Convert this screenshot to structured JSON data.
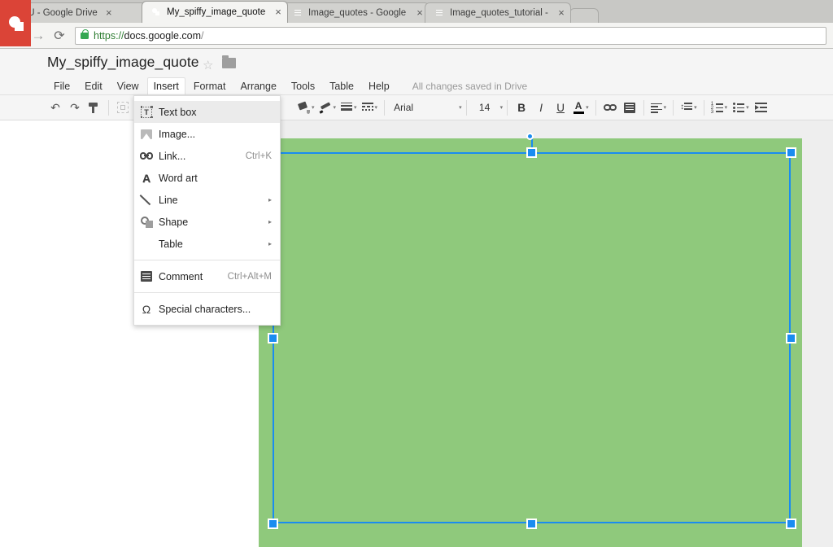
{
  "browser": {
    "tabs": [
      {
        "label": "IU - Google Drive",
        "favicon": "google-drive-icon",
        "active": false,
        "close": "×"
      },
      {
        "label": "My_spiffy_image_quote -",
        "favicon": "google-slides-icon",
        "active": true,
        "close": "×"
      },
      {
        "label": "Image_quotes - Google D",
        "favicon": "google-docs-icon",
        "active": false,
        "close": "×"
      },
      {
        "label": "Image_quotes_tutorial - G",
        "favicon": "google-docs-icon",
        "active": false,
        "close": "×"
      }
    ],
    "nav": {
      "back": "←",
      "forward": "→",
      "reload": "⟳"
    },
    "url": {
      "scheme": "https://",
      "host": "docs.google.com",
      "path": "/",
      "lock": "secure-lock-icon"
    }
  },
  "app": {
    "logo": "google-slides-logo",
    "doc_title": "My_spiffy_image_quote",
    "star": "☆",
    "folder": "folder-icon",
    "save_state": "All changes saved in Drive",
    "menus": [
      {
        "label": "File",
        "open": false
      },
      {
        "label": "Edit",
        "open": false
      },
      {
        "label": "View",
        "open": false
      },
      {
        "label": "Insert",
        "open": true
      },
      {
        "label": "Format",
        "open": false
      },
      {
        "label": "Arrange",
        "open": false
      },
      {
        "label": "Tools",
        "open": false
      },
      {
        "label": "Table",
        "open": false
      },
      {
        "label": "Help",
        "open": false
      }
    ]
  },
  "toolbar": {
    "undo": "↶",
    "redo": "↷",
    "paint_format": "paint-format-icon",
    "crop": "crop-icon",
    "fill_color": "fill-color-icon",
    "line_color": "line-color-icon",
    "line_weight": "line-weight-icon",
    "line_dash": "line-dash-icon",
    "font_name": "Arial",
    "font_size": "14",
    "bold": "B",
    "italic": "I",
    "underline": "U",
    "text_color": "A",
    "link": "insert-link-icon",
    "comment": "add-comment-icon",
    "align": "align-icon",
    "line_spacing": "line-spacing-icon",
    "numbered_list": "numbered-list-icon",
    "bulleted_list": "bulleted-list-icon",
    "indent": "indent-icon",
    "caret": "▾"
  },
  "insert_menu": {
    "items": [
      {
        "label": "Text box",
        "icon": "text-box-icon",
        "shortcut": "",
        "arrow": "",
        "highlighted": true
      },
      {
        "label": "Image...",
        "icon": "image-icon",
        "shortcut": "",
        "arrow": "",
        "highlighted": false
      },
      {
        "label": "Link...",
        "icon": "link-icon",
        "shortcut": "Ctrl+K",
        "arrow": "",
        "highlighted": false
      },
      {
        "label": "Word art",
        "icon": "word-art-icon",
        "shortcut": "",
        "arrow": "",
        "highlighted": false
      },
      {
        "label": "Line",
        "icon": "line-icon",
        "shortcut": "",
        "arrow": "▸",
        "highlighted": false
      },
      {
        "label": "Shape",
        "icon": "shape-icon",
        "shortcut": "",
        "arrow": "▸",
        "highlighted": false
      },
      {
        "label": "Table",
        "icon": "",
        "shortcut": "",
        "arrow": "▸",
        "highlighted": false
      },
      {
        "label": "Comment",
        "icon": "comment-icon",
        "shortcut": "Ctrl+Alt+M",
        "arrow": "",
        "highlighted": false
      },
      {
        "label": "Special characters...",
        "icon": "special-characters-icon",
        "shortcut": "",
        "arrow": "",
        "highlighted": false
      }
    ]
  },
  "canvas": {
    "slide_fill": "#8fc97c",
    "workspace_bg": "#eeeeee",
    "selection_color": "#1a8cf0",
    "selected_object": "green-rectangle-shape"
  }
}
